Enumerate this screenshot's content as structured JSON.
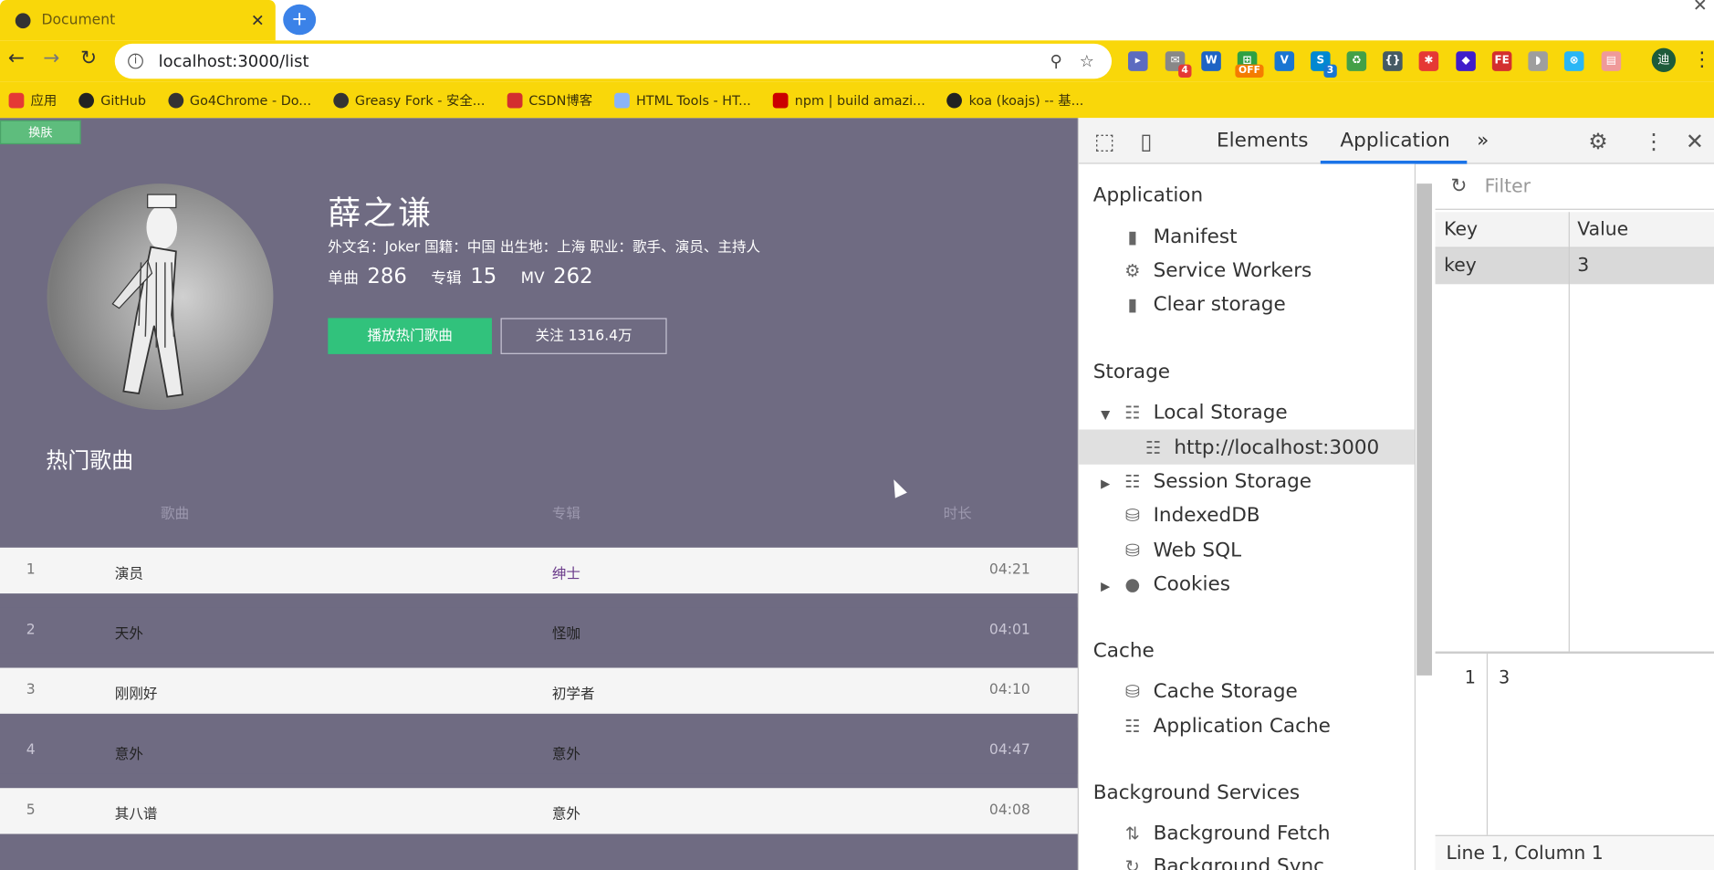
{
  "browser": {
    "tab_title": "Document",
    "tab_close": "✕",
    "new_tab": "+",
    "window_close": "✕",
    "url": "localhost:3000/list",
    "avatar_letter": "迪",
    "bookmarks": [
      {
        "label": "应用",
        "color": "#e53935"
      },
      {
        "label": "GitHub",
        "color": "#222"
      },
      {
        "label": "Go4Chrome - Do...",
        "color": "#333"
      },
      {
        "label": "Greasy Fork - 安全...",
        "color": "#333"
      },
      {
        "label": "CSDN博客",
        "color": "#d32f2f"
      },
      {
        "label": "HTML Tools - HT...",
        "color": "#8ab4f8"
      },
      {
        "label": "npm | build amazi...",
        "color": "#cb0000"
      },
      {
        "label": "koa (koajs) -- 基...",
        "color": "#222"
      }
    ]
  },
  "page": {
    "skin_button": "换肤",
    "artist": {
      "name": "薛之谦",
      "info": "外文名：Joker 国籍：中国 出生地：上海 职业：歌手、演员、主持人",
      "stats": [
        {
          "label": "单曲",
          "value": "286"
        },
        {
          "label": "专辑",
          "value": "15"
        },
        {
          "label": "MV",
          "value": "262"
        }
      ],
      "play_button": "播放热门歌曲",
      "follow_button": "关注 1316.4万"
    },
    "section_title": "热门歌曲",
    "columns": {
      "song": "歌曲",
      "album": "专辑",
      "duration": "时长"
    },
    "songs": [
      {
        "idx": "1",
        "song": "演员",
        "album": "绅士",
        "dur": "04:21"
      },
      {
        "idx": "2",
        "song": "天外",
        "album": "怪咖",
        "dur": "04:01"
      },
      {
        "idx": "3",
        "song": "刚刚好",
        "album": "初学者",
        "dur": "04:10"
      },
      {
        "idx": "4",
        "song": "意外",
        "album": "意外",
        "dur": "04:47"
      },
      {
        "idx": "5",
        "song": "其八谱",
        "album": "意外",
        "dur": "04:08"
      }
    ]
  },
  "devtools": {
    "tabs": {
      "elements": "Elements",
      "application": "Application",
      "more": "»"
    },
    "sections": {
      "application": "Application",
      "storage": "Storage",
      "cache": "Cache",
      "background": "Background Services"
    },
    "items": {
      "manifest": "Manifest",
      "service_workers": "Service Workers",
      "clear_storage": "Clear storage",
      "local_storage": "Local Storage",
      "localhost": "http://localhost:3000",
      "session_storage": "Session Storage",
      "indexeddb": "IndexedDB",
      "websql": "Web SQL",
      "cookies": "Cookies",
      "cache_storage": "Cache Storage",
      "app_cache": "Application Cache",
      "bg_fetch": "Background Fetch",
      "bg_sync": "Background Sync"
    },
    "filter_placeholder": "Filter",
    "grid": {
      "key_header": "Key",
      "value_header": "Value",
      "row_key": "key",
      "row_value": "3"
    },
    "preview": {
      "line_no": "1",
      "value": "3"
    },
    "status": "Line 1, Column 1"
  }
}
